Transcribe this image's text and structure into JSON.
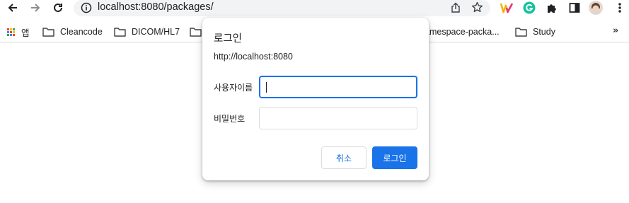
{
  "browser": {
    "url": "localhost:8080/packages/",
    "colors": {
      "accent": "#1a73e8",
      "omnibox_bg": "#f1f3f4"
    }
  },
  "bookmarks": {
    "apps_label": "앱",
    "items": [
      {
        "label": "Cleancode",
        "icon": "folder-icon"
      },
      {
        "label": "DICOM/HL7",
        "icon": "folder-icon"
      },
      {
        "label": "amespace-packa...",
        "icon": "folder-icon"
      },
      {
        "label": "Study",
        "icon": "folder-icon"
      }
    ],
    "overflow": "»"
  },
  "dialog": {
    "title": "로그인",
    "origin": "http://localhost:8080",
    "username_label": "사용자이름",
    "username_value": "",
    "password_label": "비밀번호",
    "password_value": "",
    "cancel_label": "취소",
    "login_label": "로그인"
  }
}
